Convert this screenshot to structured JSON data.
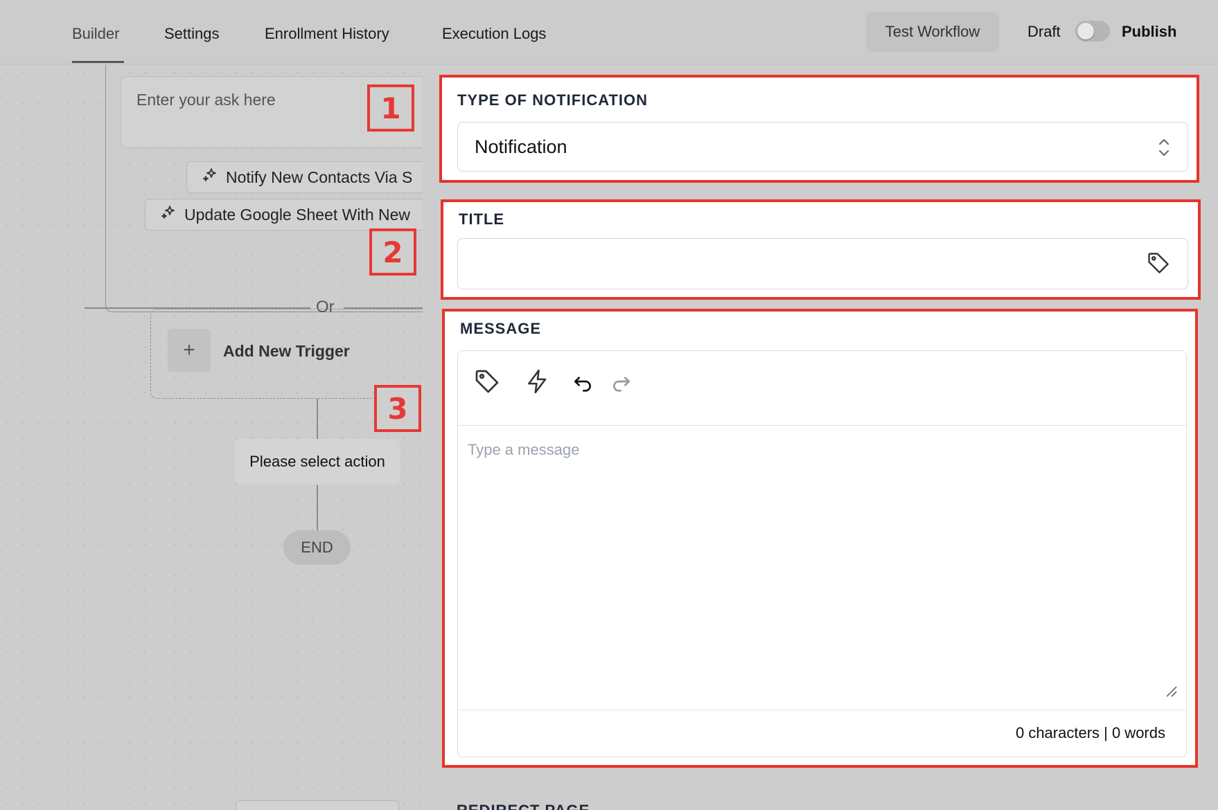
{
  "topbar": {
    "tabs": [
      {
        "label": "Builder",
        "active": true
      },
      {
        "label": "Settings",
        "active": false
      },
      {
        "label": "Enrollment History",
        "active": false
      },
      {
        "label": "Execution Logs",
        "active": false
      }
    ],
    "test_workflow_label": "Test Workflow",
    "draft_label": "Draft",
    "publish_label": "Publish",
    "publish_toggle_on": false
  },
  "canvas": {
    "ask_placeholder": "Enter your ask here",
    "chips": [
      {
        "label": "Notify New Contacts Via S",
        "icon": "sparkles-icon"
      },
      {
        "label": "Update Google Sheet With New",
        "icon": "sparkles-icon"
      }
    ],
    "or_label": "Or",
    "add_trigger_icon": "+",
    "add_trigger_label": "Add New Trigger",
    "action_label": "Please select action",
    "end_label": "END"
  },
  "annotations": [
    "1",
    "2",
    "3"
  ],
  "form": {
    "type_label": "TYPE OF NOTIFICATION",
    "type_value": "Notification",
    "title_label": "TITLE",
    "title_value": "",
    "message_label": "MESSAGE",
    "message_placeholder": "Type a message",
    "message_counter": "0 characters | 0 words",
    "next_label": "REDIRECT PAGE"
  },
  "colors": {
    "highlight": "#e5352b",
    "background": "#cdcdcd"
  }
}
